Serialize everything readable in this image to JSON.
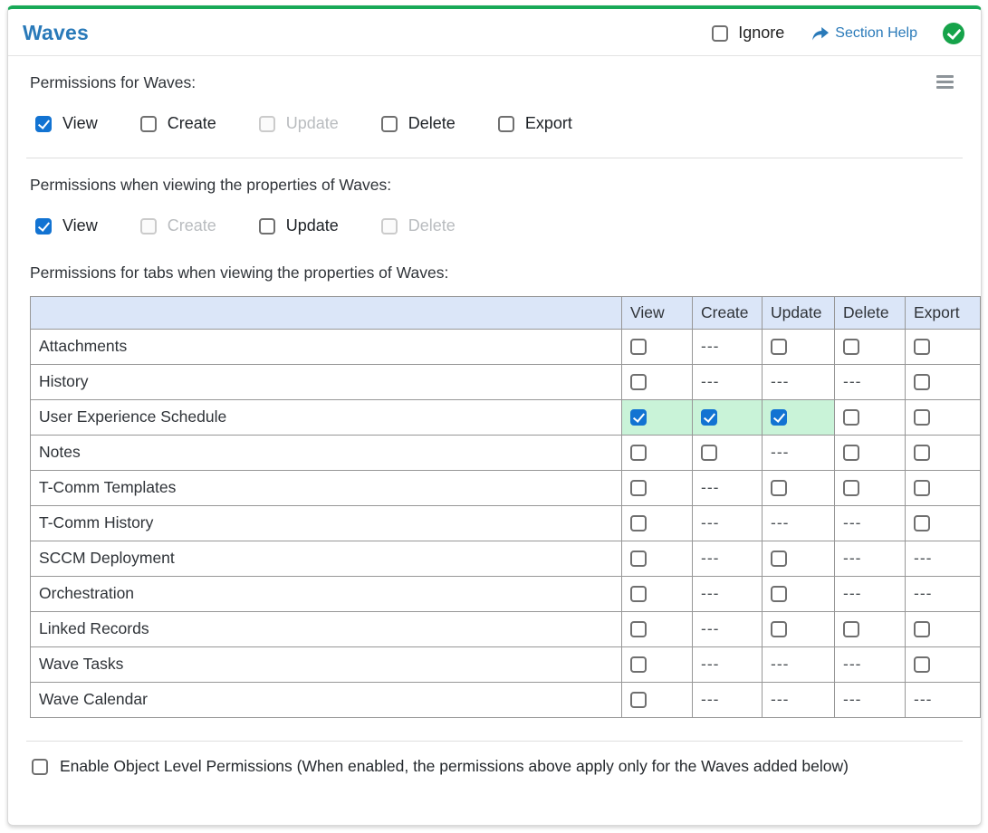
{
  "window": {
    "title": "Waves"
  },
  "header": {
    "ignore_label": "Ignore",
    "section_help_label": "Section Help"
  },
  "sections": {
    "main": {
      "label": "Permissions for Waves:",
      "options": [
        {
          "label": "View",
          "state": "checked"
        },
        {
          "label": "Create",
          "state": "unchecked"
        },
        {
          "label": "Update",
          "state": "disabled"
        },
        {
          "label": "Delete",
          "state": "unchecked"
        },
        {
          "label": "Export",
          "state": "unchecked"
        }
      ]
    },
    "properties": {
      "label": "Permissions when viewing the properties of Waves:",
      "options": [
        {
          "label": "View",
          "state": "checked"
        },
        {
          "label": "Create",
          "state": "disabled"
        },
        {
          "label": "Update",
          "state": "unchecked"
        },
        {
          "label": "Delete",
          "state": "disabled"
        }
      ]
    },
    "tabs": {
      "label": "Permissions for tabs when viewing the properties of Waves:"
    }
  },
  "table": {
    "columns": [
      "View",
      "Create",
      "Update",
      "Delete",
      "Export"
    ],
    "none_marker": "---",
    "rows": [
      {
        "label": "Attachments",
        "cells": [
          "unchecked",
          "none",
          "unchecked",
          "unchecked",
          "unchecked"
        ]
      },
      {
        "label": "History",
        "cells": [
          "unchecked",
          "none",
          "none",
          "none",
          "unchecked"
        ]
      },
      {
        "label": "User Experience Schedule",
        "cells": [
          "checked-hl",
          "checked-hl",
          "checked-hl",
          "unchecked",
          "unchecked"
        ]
      },
      {
        "label": "Notes",
        "cells": [
          "unchecked",
          "unchecked",
          "none",
          "unchecked",
          "unchecked"
        ]
      },
      {
        "label": "T-Comm Templates",
        "cells": [
          "unchecked",
          "none",
          "unchecked",
          "unchecked",
          "unchecked"
        ]
      },
      {
        "label": "T-Comm History",
        "cells": [
          "unchecked",
          "none",
          "none",
          "none",
          "unchecked"
        ]
      },
      {
        "label": "SCCM Deployment",
        "cells": [
          "unchecked",
          "none",
          "unchecked",
          "none",
          "none"
        ]
      },
      {
        "label": "Orchestration",
        "cells": [
          "unchecked",
          "none",
          "unchecked",
          "none",
          "none"
        ]
      },
      {
        "label": "Linked Records",
        "cells": [
          "unchecked",
          "none",
          "unchecked",
          "unchecked",
          "unchecked"
        ]
      },
      {
        "label": "Wave Tasks",
        "cells": [
          "unchecked",
          "none",
          "none",
          "none",
          "unchecked"
        ]
      },
      {
        "label": "Wave Calendar",
        "cells": [
          "unchecked",
          "none",
          "none",
          "none",
          "none"
        ]
      }
    ]
  },
  "footer": {
    "object_level_label": "Enable Object Level Permissions (When enabled, the permissions above apply only for the Waves added below)"
  },
  "colors": {
    "accent_green": "#18a957",
    "status_badge_green": "#16a34a",
    "checked_blue": "#1273d2",
    "highlight_green": "#c9f3d8",
    "table_header_bg": "#dbe6f8",
    "link_blue": "#2a7ab9"
  }
}
